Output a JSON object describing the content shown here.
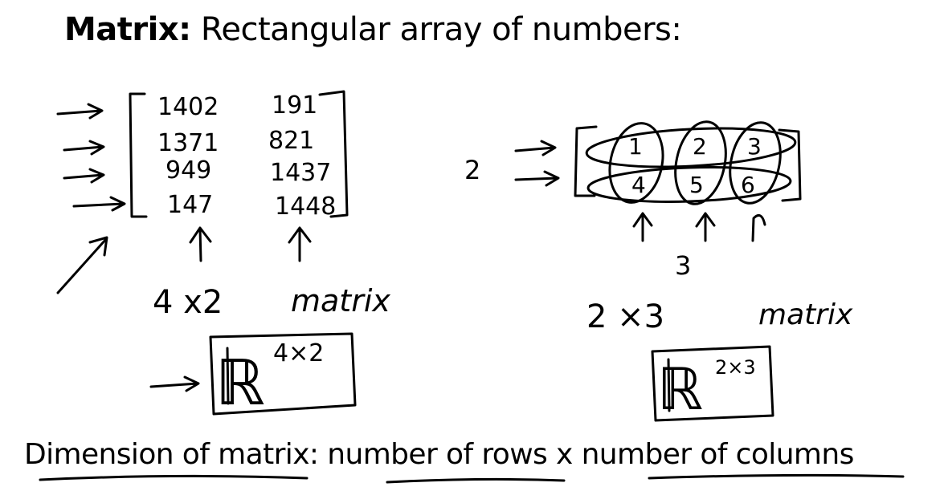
{
  "title": {
    "term": "Matrix:",
    "definition": "Rectangular array of numbers:"
  },
  "left_example": {
    "rows": [
      [
        "1402",
        "191"
      ],
      [
        "1371",
        "821"
      ],
      [
        "949",
        "1437"
      ],
      [
        "147",
        "1448"
      ]
    ],
    "dimension_label": "4 x2",
    "matrix_word": "matrix",
    "set_symbol": "ℝ",
    "set_exponent": "4×2"
  },
  "right_example": {
    "rows": [
      [
        "1",
        "2",
        "3"
      ],
      [
        "4",
        "5",
        "6"
      ]
    ],
    "row_count": "2",
    "column_count": "3",
    "dimension_label": "2 ×3",
    "matrix_word": "matrix",
    "set_symbol": "ℝ",
    "set_exponent": "2×3"
  },
  "footer": {
    "text": "Dimension of matrix: number of rows x number of columns"
  }
}
